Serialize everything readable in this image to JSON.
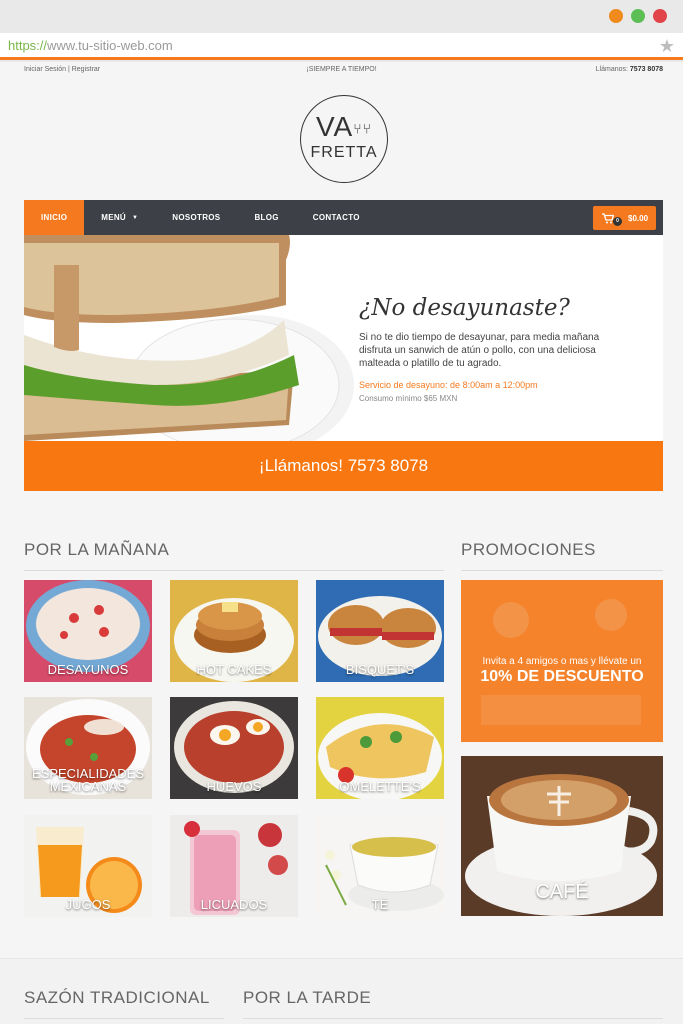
{
  "browser": {
    "url_scheme": "https://",
    "url_rest": "www.tu-sitio-web.com",
    "dot_colors": [
      "#f08a1c",
      "#5cbf55",
      "#e1454a"
    ]
  },
  "topbar": {
    "login": "Iniciar Sesión | Registrar",
    "tagline": "¡SIEMPRE A TIEMPO!",
    "call_label": "Llámanos:",
    "call_number": "7573 8078"
  },
  "logo": {
    "line1": "VA",
    "line2": "FRETTA"
  },
  "nav": {
    "items": [
      "INICIO",
      "MENÚ",
      "NOSOTROS",
      "BLOG",
      "CONTACTO"
    ],
    "cart_total": "$0.00",
    "cart_count": "0"
  },
  "hero": {
    "title": "¿No desayunaste?",
    "body": "Si no te dio tiempo de desayunar, para media mañana disfruta un sanwich de atún o pollo, con una deliciosa malteada o platillo de tu agrado.",
    "service": "Servicio de desayuno: de 8:00am a 12:00pm",
    "minimum": "Consumo mínimo $65 MXN"
  },
  "call_banner": "¡Llámanos! 7573 8078",
  "sections": {
    "morning": "POR LA MAÑANA",
    "promos": "PROMOCIONES",
    "traditional": "SAZÓN TRADICIONAL",
    "afternoon": "POR LA TARDE"
  },
  "menu_tiles": [
    "DESAYUNOS",
    "HOT CAKES",
    "BISQUET'S",
    "ESPECIALIDADES MEXICANAS",
    "HUEVOS",
    "OMELETTE'S",
    "JUGOS",
    "LICUADOS",
    "TÉ"
  ],
  "promo": {
    "line1": "Invita a 4 amigos o mas y llévate un",
    "line2": "10% DE DESCUENTO"
  },
  "cafe_label": "CAFÉ",
  "colors": {
    "accent": "#f57a1f",
    "nav_bg": "#3d4047"
  }
}
